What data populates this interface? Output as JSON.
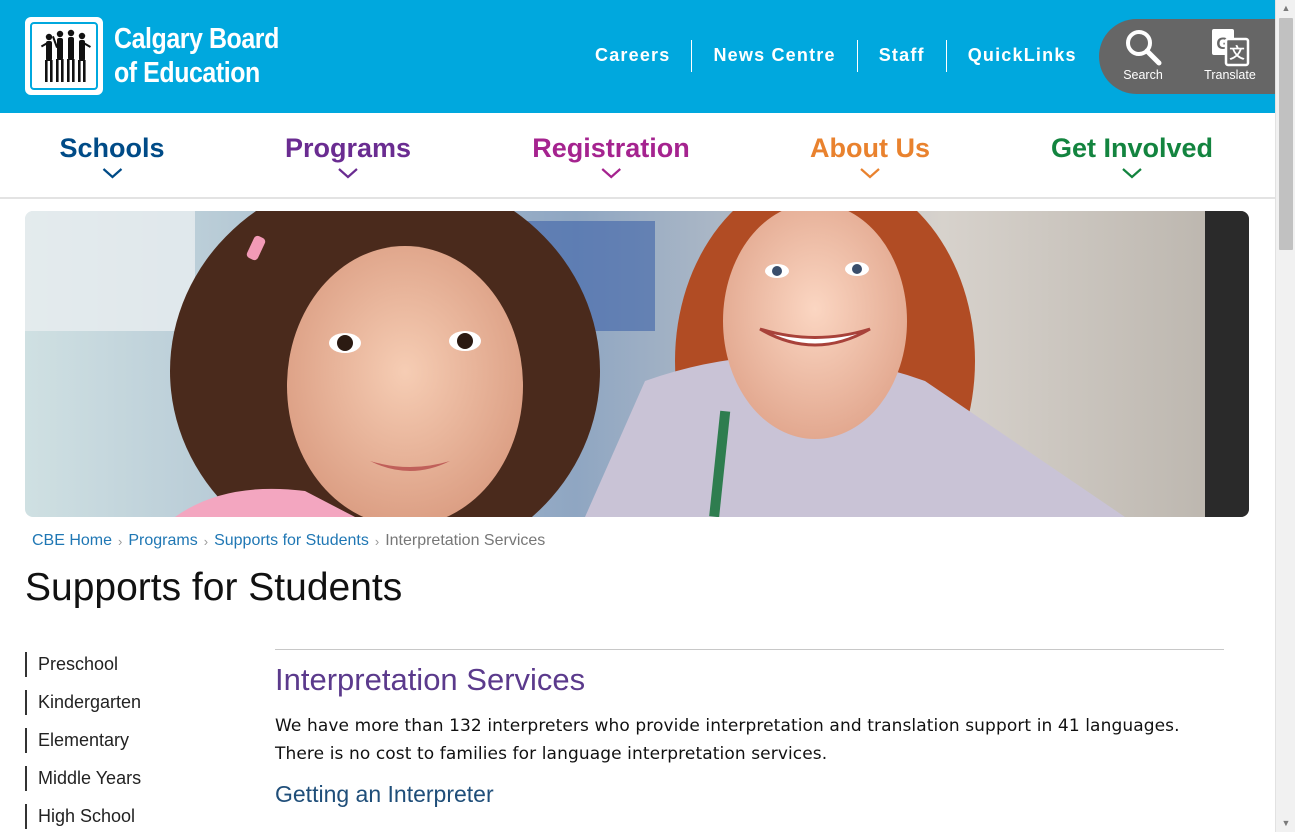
{
  "header": {
    "logo_line1": "Calgary Board",
    "logo_line2": "of Education",
    "utility_links": [
      "Careers",
      "News Centre",
      "Staff",
      "QuickLinks"
    ],
    "search_label": "Search",
    "translate_label": "Translate"
  },
  "main_nav": [
    {
      "label": "Schools",
      "color": "#004b87"
    },
    {
      "label": "Programs",
      "color": "#6a2c91"
    },
    {
      "label": "Registration",
      "color": "#a5238f"
    },
    {
      "label": "About Us",
      "color": "#e9822e"
    },
    {
      "label": "Get Involved",
      "color": "#13843f"
    }
  ],
  "breadcrumb": [
    "CBE Home",
    "Programs",
    "Supports for Students",
    "Interpretation Services"
  ],
  "page_title": "Supports for Students",
  "sidebar": {
    "items": [
      "Preschool",
      "Kindergarten",
      "Elementary",
      "Middle Years",
      "High School"
    ]
  },
  "content": {
    "heading": "Interpretation Services",
    "paragraph": "We have more than 132 interpreters who provide interpretation and translation support in 41 languages. There is no cost to families for language interpretation services.",
    "subheading": "Getting an Interpreter"
  },
  "colors": {
    "header_bg": "#00a8de",
    "tools_bg": "#666666",
    "link": "#1f77b4",
    "heading_purple": "#5b3a8c"
  }
}
